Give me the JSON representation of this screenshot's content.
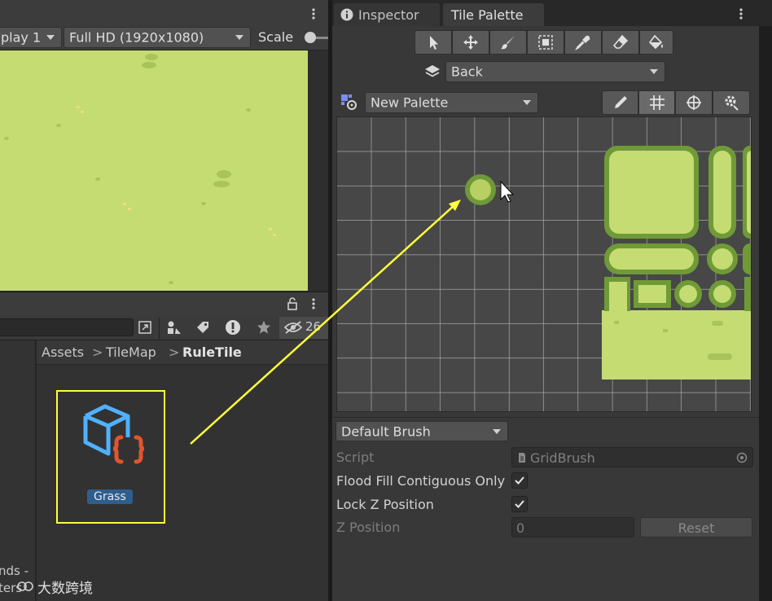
{
  "game_view": {
    "display_label": "play 1",
    "resolution_label": "Full HD (1920x1080)",
    "scale_label": "Scale"
  },
  "project": {
    "hidden_count": "26",
    "breadcrumb": {
      "part1": "Assets",
      "part2": "TileMap",
      "current": "RuleTile"
    },
    "asset_label": "Grass",
    "left_fragment_1": "nds -",
    "left_fragment_2": "ters"
  },
  "watermark": {
    "text": "大数跨境"
  },
  "inspector": {
    "tab_label": "Inspector"
  },
  "tile_palette": {
    "tab_label": "Tile Palette",
    "active_target": "Back",
    "palette_name": "New Palette",
    "brush": "Default Brush",
    "props": {
      "script_label": "Script",
      "script_value": "GridBrush",
      "flood_fill_label": "Flood Fill Contiguous Only",
      "lock_z_label": "Lock Z Position",
      "z_position_label": "Z Position",
      "z_position_value": "0",
      "reset_label": "Reset"
    }
  },
  "colors": {
    "grass_light": "#c5dc73",
    "grass_dark": "#6f9a37",
    "highlight_yellow": "#ffff3a",
    "asset_icon_blue": "#4fb1ff",
    "asset_icon_orange": "#e0552e",
    "badge_blue": "#2d5e8e"
  }
}
